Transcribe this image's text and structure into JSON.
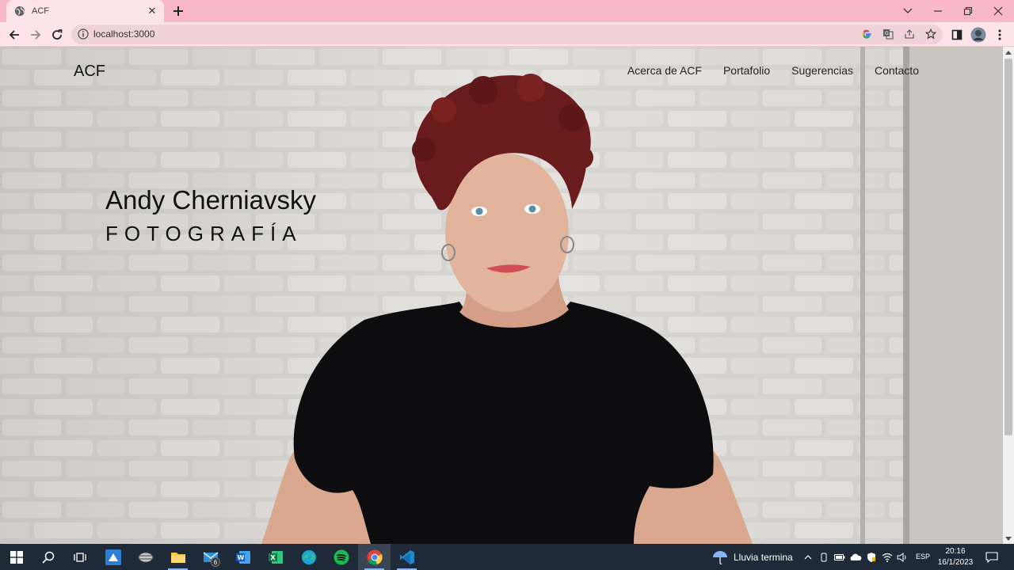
{
  "browser": {
    "tab_title": "ACF",
    "url": "localhost:3000"
  },
  "site": {
    "logo": "ACF",
    "nav": [
      "Acerca de ACF",
      "Portafolio",
      "Sugerencias",
      "Contacto"
    ],
    "hero_title": "Andy Cherniavsky",
    "hero_subtitle": "FOTOGRAFÍA"
  },
  "taskbar": {
    "mail_badge": "6",
    "weather_text": "Lluvia termina",
    "language": "ESP",
    "time": "20:16",
    "date": "16/1/2023"
  },
  "colors": {
    "tab_strip": "#f8b8c8",
    "toolbar": "#fce4ea",
    "omnibox": "#f0d2da",
    "taskbar": "#1f2a38"
  }
}
